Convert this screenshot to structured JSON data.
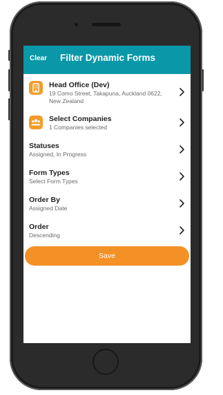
{
  "header": {
    "clear_label": "Clear",
    "title": "Filter Dynamic Forms"
  },
  "office": {
    "title": "Head Office (Dev)",
    "address_line1": "19 Como Street, Takapuna, Auckland 0622,",
    "address_line2": "New Zealand",
    "icon": "building-icon"
  },
  "companies": {
    "title": "Select Companies",
    "subtitle": "1 Companies selected",
    "icon": "group-icon"
  },
  "statuses": {
    "title": "Statuses",
    "subtitle": "Assigned, In Progress"
  },
  "form_types": {
    "title": "Form Types",
    "subtitle": "Select Form Types"
  },
  "order_by": {
    "title": "Order By",
    "subtitle": "Assigned Date"
  },
  "order": {
    "title": "Order",
    "subtitle": "Descending"
  },
  "save_label": "Save",
  "colors": {
    "header_bg": "#0a98a8",
    "accent": "#f39126",
    "phone_body": "#2b2b2b"
  }
}
